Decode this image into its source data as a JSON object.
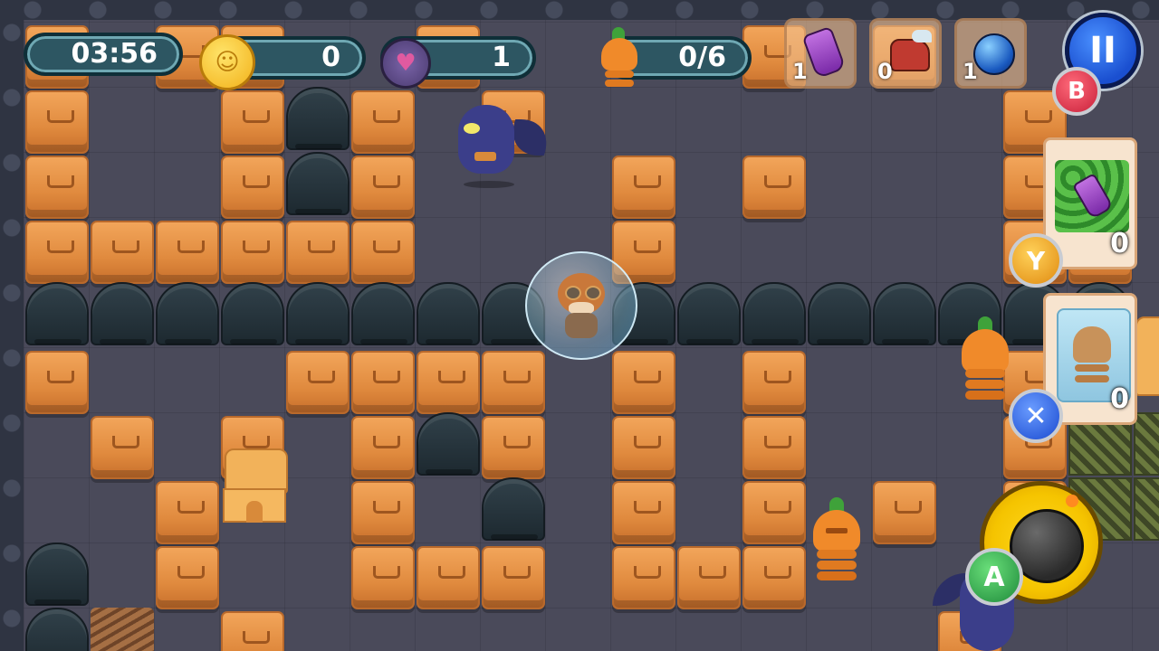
{
  "hud": {
    "timer": "03:56",
    "coins": "0",
    "gems": "1",
    "carrots": "0/6"
  },
  "items": [
    {
      "name": "purple-potion",
      "count": "1"
    },
    {
      "name": "winged-boot",
      "count": "0"
    },
    {
      "name": "blue-orb",
      "count": "1"
    }
  ],
  "buttons": {
    "pause": "II",
    "b": "B",
    "y": "Y",
    "x": "✕",
    "a": "A"
  },
  "cards": [
    {
      "name": "potion-hedge-card",
      "count": "0"
    },
    {
      "name": "frozen-carrot-card",
      "count": "0"
    }
  ],
  "colors": {
    "crate": "#e08a3e",
    "floor": "#4a4a5a",
    "hud_pill": "#2d5662",
    "bomb_ring": "#f5c400",
    "a_button": "#3aa657",
    "b_button": "#d8344a",
    "y_button": "#f0a020",
    "x_button": "#3a6fd8"
  }
}
